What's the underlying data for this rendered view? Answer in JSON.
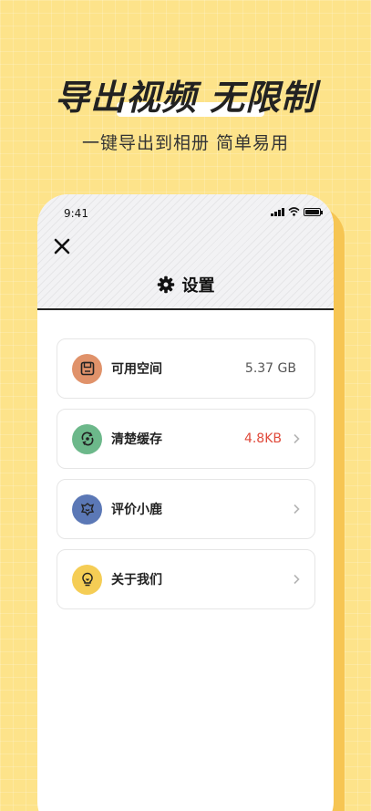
{
  "promo": {
    "headline": "导出视频 无限制",
    "subline": "一键导出到相册 简单易用"
  },
  "status_bar": {
    "time": "9:41"
  },
  "header": {
    "title": "设置"
  },
  "items": [
    {
      "label": "可用空间",
      "value": "5.37 GB",
      "icon": "save-icon",
      "icon_color": "#e0926a",
      "chevron": false
    },
    {
      "label": "清楚缓存",
      "value": "4.8KB",
      "icon": "clear-cache-icon",
      "icon_color": "#6cb88a",
      "chevron": true
    },
    {
      "label": "评价小鹿",
      "value": "",
      "icon": "rate-icon",
      "icon_color": "#5b78b6",
      "chevron": true
    },
    {
      "label": "关于我们",
      "value": "",
      "icon": "about-icon",
      "icon_color": "#f5cd55",
      "chevron": true
    }
  ],
  "colors": {
    "background": "#fde38a",
    "accent_red": "#e04a3b"
  }
}
